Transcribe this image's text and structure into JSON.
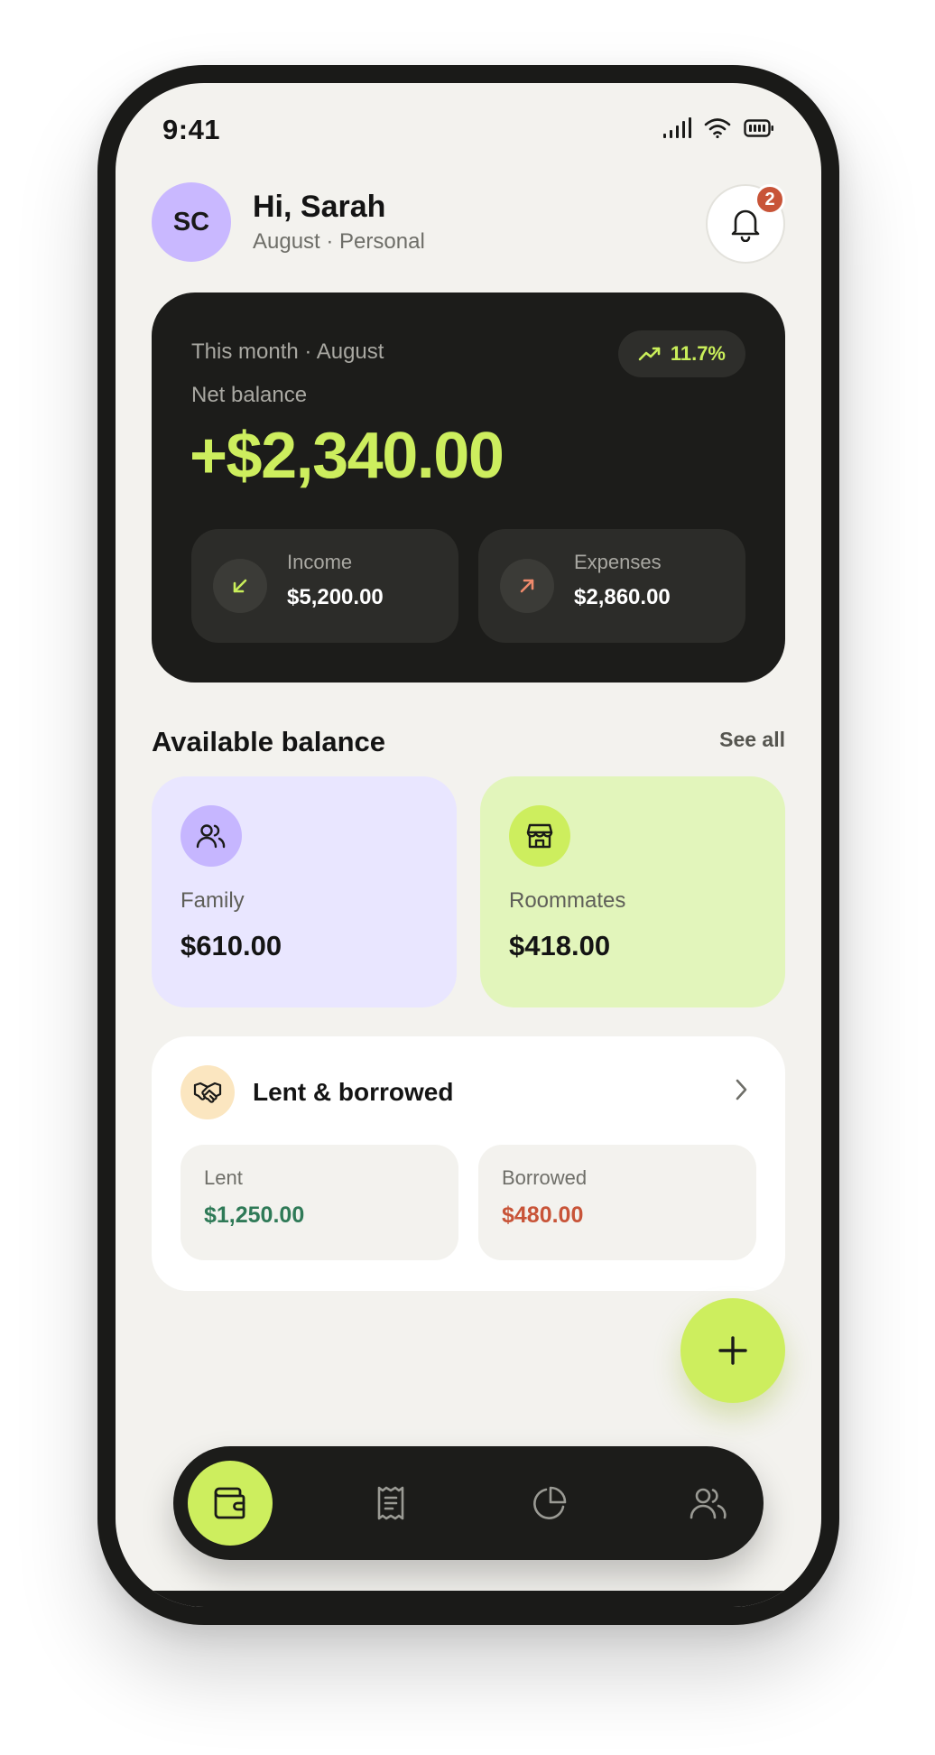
{
  "status_bar": {
    "time": "9:41"
  },
  "header": {
    "avatar_initials": "SC",
    "greeting": "Hi, Sarah",
    "subtitle": "August · Personal",
    "notification_count": "2"
  },
  "balance_card": {
    "period": "This month · August",
    "trend": "11.7%",
    "net_label": "Net balance",
    "net_amount": "+$2,340.00",
    "income_label": "Income",
    "income_value": "$5,200.00",
    "expenses_label": "Expenses",
    "expenses_value": "$2,860.00"
  },
  "available": {
    "title": "Available balance",
    "see_all": "See all",
    "wallets": [
      {
        "name": "Family",
        "amount": "$610.00",
        "icon": "people-icon"
      },
      {
        "name": "Roommates",
        "amount": "$418.00",
        "icon": "store-icon"
      }
    ]
  },
  "lent_borrowed": {
    "title": "Lent & borrowed",
    "icon": "handshake-icon",
    "lent_label": "Lent",
    "lent_value": "$1,250.00",
    "borrowed_label": "Borrowed",
    "borrowed_value": "$480.00"
  },
  "nav": {
    "items": [
      {
        "icon": "wallet-icon",
        "active": true
      },
      {
        "icon": "receipt-icon",
        "active": false
      },
      {
        "icon": "pie-chart-icon",
        "active": false
      },
      {
        "icon": "people-icon",
        "active": false
      }
    ]
  },
  "colors": {
    "accent": "#cdee5e",
    "dark": "#1c1c1a",
    "background": "#f3f2ee",
    "lavender": "#e9e6ff",
    "lime_light": "#e2f5bb",
    "positive": "#2f7a57",
    "negative": "#c85438"
  }
}
